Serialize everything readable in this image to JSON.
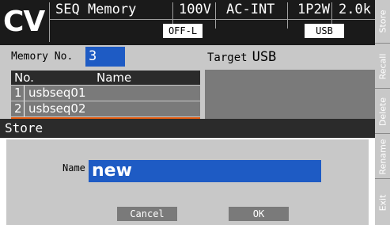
{
  "status": {
    "mode": "CV",
    "title": "SEQ Memory",
    "voltage": "100V",
    "source": "AC-INT",
    "wiring": "1P2W",
    "range": "2.0k",
    "output": "OFF-L",
    "target_badge": "USB"
  },
  "main": {
    "memory_label": "Memory No.",
    "memory_value": "3",
    "target_label": "Target",
    "target_value": "USB",
    "list_headers": {
      "no": "No.",
      "name": "Name"
    },
    "rows": [
      {
        "no": "1",
        "name": "usbseq01"
      },
      {
        "no": "2",
        "name": "usbseq02"
      }
    ]
  },
  "softkeys": [
    "Store",
    "Recall",
    "Delete",
    "Rename",
    "Exit"
  ],
  "dialog": {
    "title": "Store",
    "name_label": "Name",
    "name_value": "new",
    "cancel_label": "Cancel",
    "ok_label": "OK"
  },
  "colors": {
    "highlight": "#1e5bc4",
    "selected_row": "#e05a10"
  }
}
